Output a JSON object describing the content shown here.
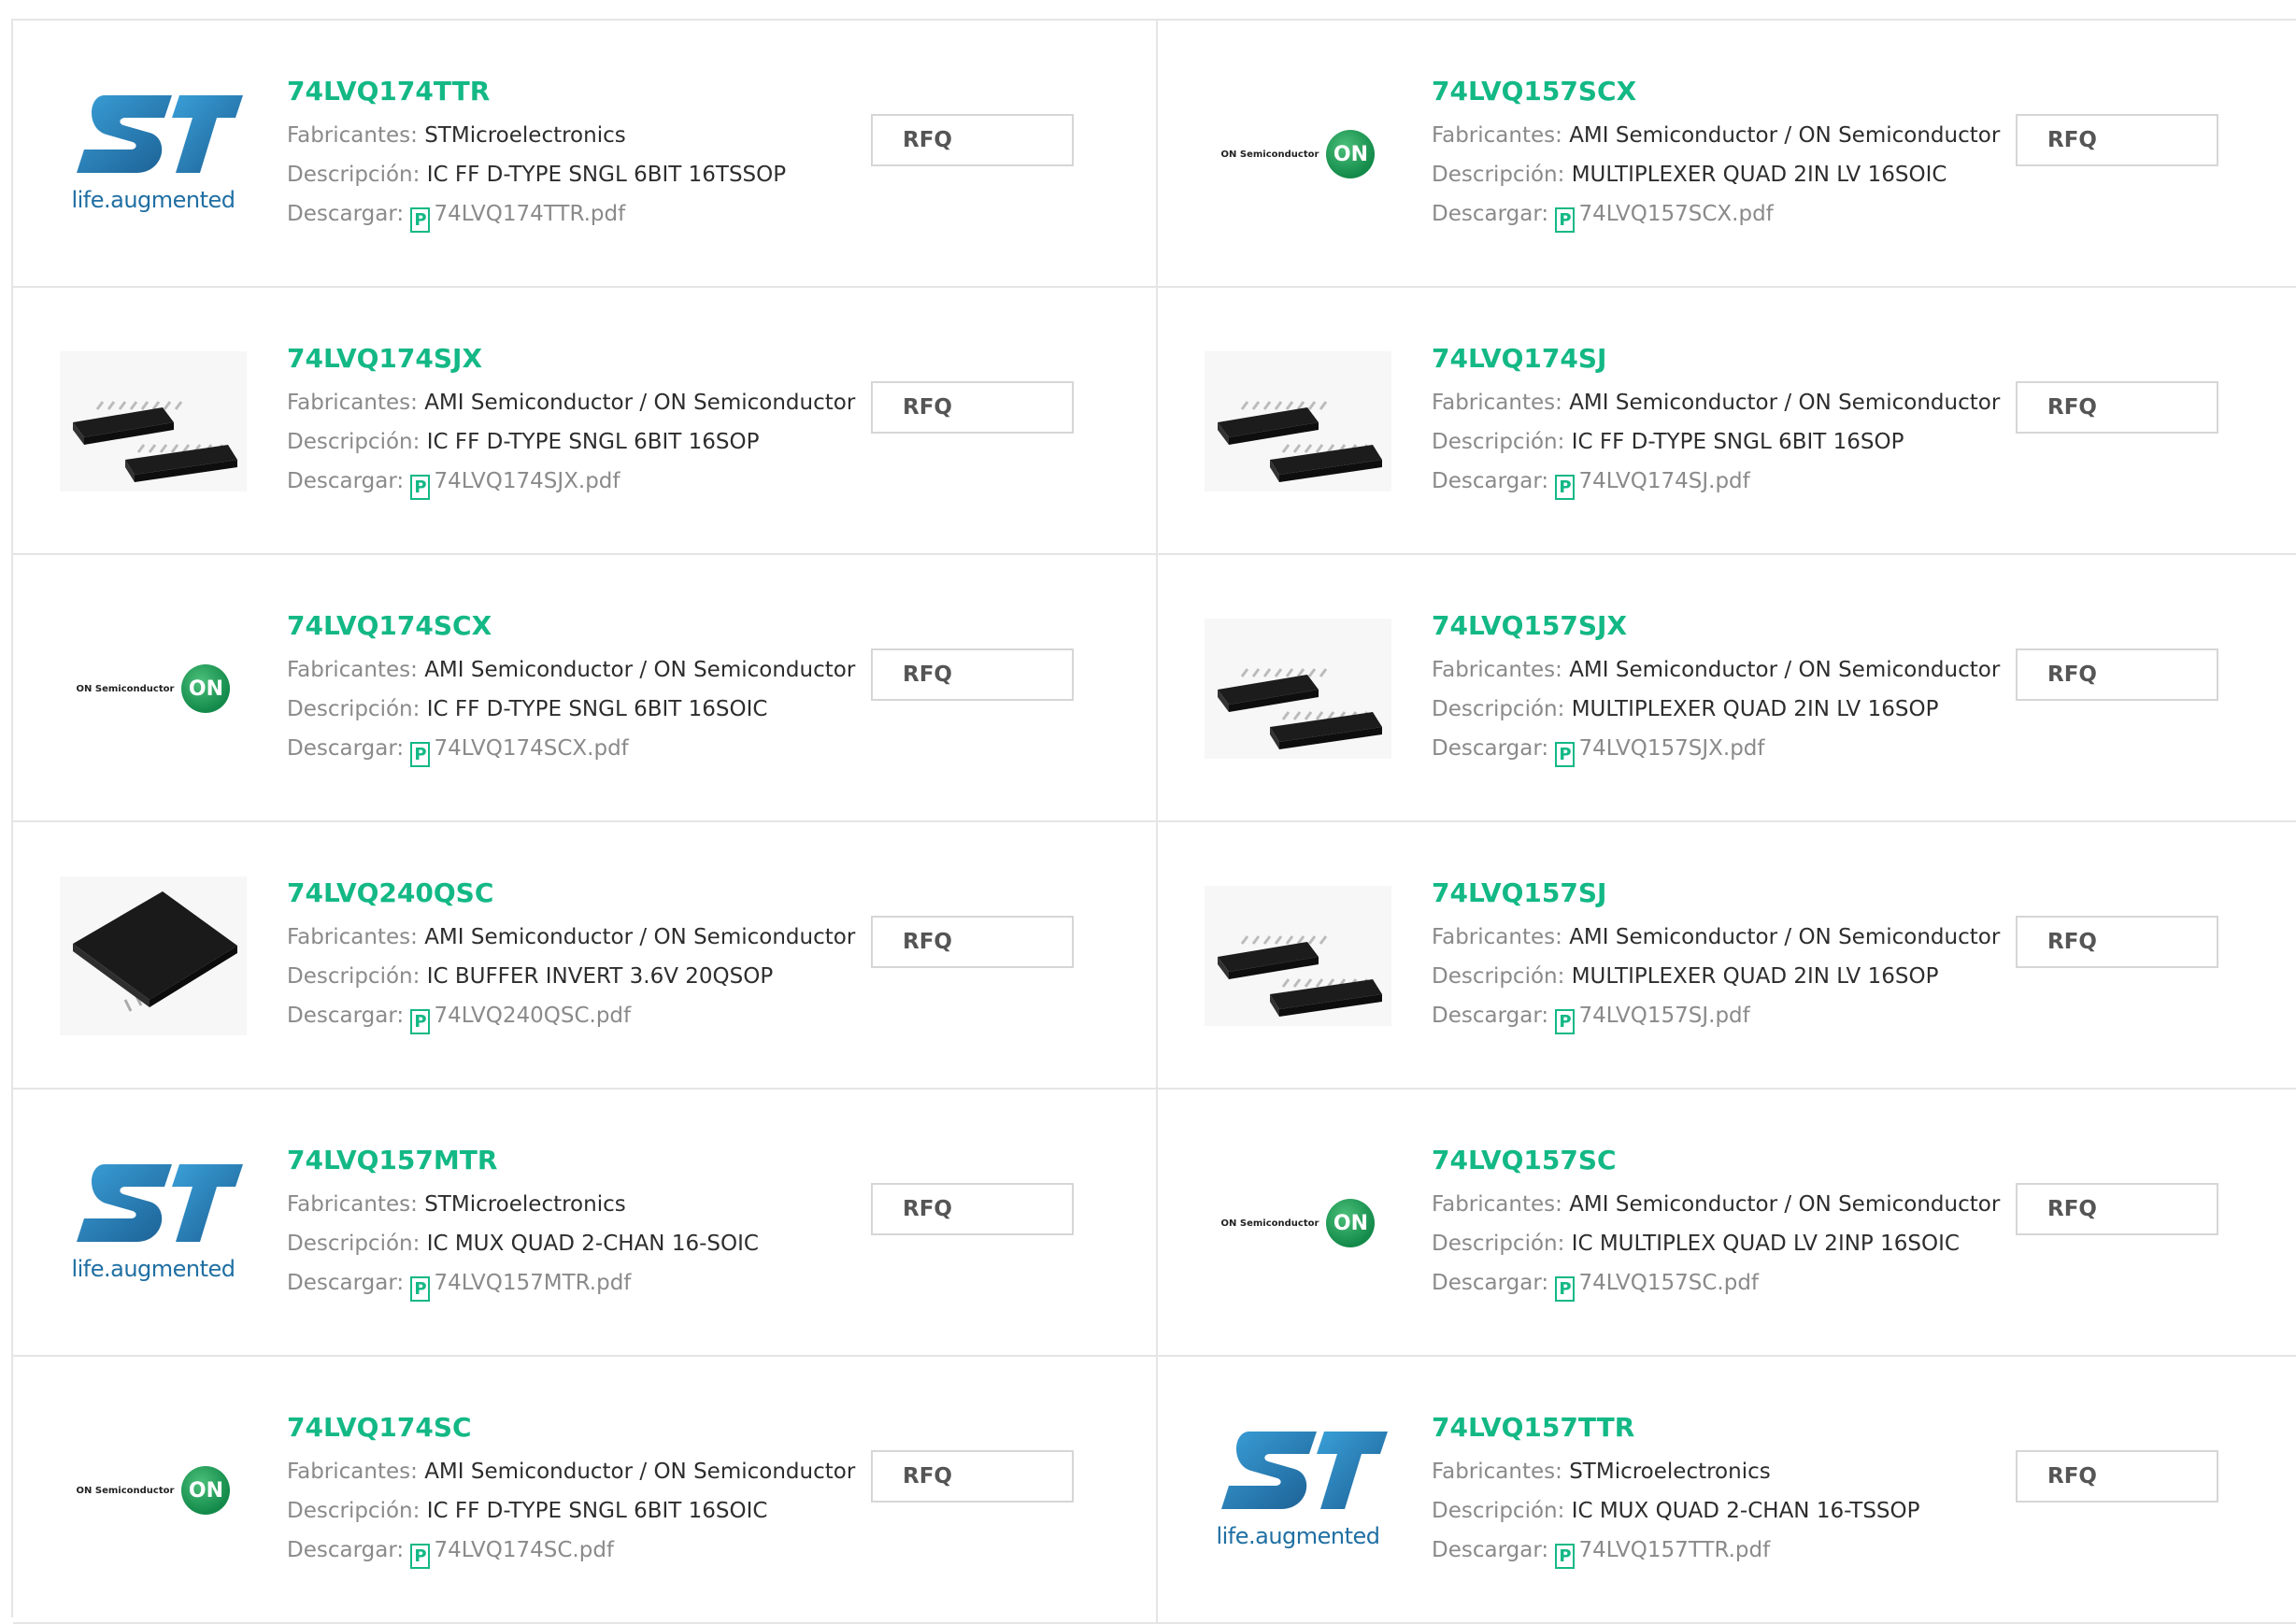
{
  "labels": {
    "manufacturer": "Fabricantes:",
    "description": "Descripción:",
    "download": "Descargar:",
    "rfq": "RFQ",
    "pdf_glyph": "P",
    "st_tagline": "life.augmented",
    "on_wordmark": "ON Semiconductor",
    "on_badge": "ON"
  },
  "colors": {
    "accent_green": "#13b885",
    "border": "#e5e5e5",
    "label_gray": "#8a8a8a",
    "st_blue": "#1f6fa3"
  },
  "products": [
    {
      "part": "74LVQ174TTR",
      "manufacturer": "STMicroelectronics",
      "description": "IC FF D-TYPE SNGL 6BIT 16TSSOP",
      "pdf": "74LVQ174TTR.pdf",
      "logo": "st"
    },
    {
      "part": "74LVQ157SCX",
      "manufacturer": "AMI Semiconductor / ON Semiconductor",
      "description": "MULTIPLEXER QUAD 2IN LV 16SOIC",
      "pdf": "74LVQ157SCX.pdf",
      "logo": "on"
    },
    {
      "part": "74LVQ174SJX",
      "manufacturer": "AMI Semiconductor / ON Semiconductor",
      "description": "IC FF D-TYPE SNGL 6BIT 16SOP",
      "pdf": "74LVQ174SJX.pdf",
      "logo": "chip-sop"
    },
    {
      "part": "74LVQ174SJ",
      "manufacturer": "AMI Semiconductor / ON Semiconductor",
      "description": "IC FF D-TYPE SNGL 6BIT 16SOP",
      "pdf": "74LVQ174SJ.pdf",
      "logo": "chip-sop"
    },
    {
      "part": "74LVQ174SCX",
      "manufacturer": "AMI Semiconductor / ON Semiconductor",
      "description": "IC FF D-TYPE SNGL 6BIT 16SOIC",
      "pdf": "74LVQ174SCX.pdf",
      "logo": "on"
    },
    {
      "part": "74LVQ157SJX",
      "manufacturer": "AMI Semiconductor / ON Semiconductor",
      "description": "MULTIPLEXER QUAD 2IN LV 16SOP",
      "pdf": "74LVQ157SJX.pdf",
      "logo": "chip-sop"
    },
    {
      "part": "74LVQ240QSC",
      "manufacturer": "AMI Semiconductor / ON Semiconductor",
      "description": "IC BUFFER INVERT 3.6V 20QSOP",
      "pdf": "74LVQ240QSC.pdf",
      "logo": "chip-qsop"
    },
    {
      "part": "74LVQ157SJ",
      "manufacturer": "AMI Semiconductor / ON Semiconductor",
      "description": "MULTIPLEXER QUAD 2IN LV 16SOP",
      "pdf": "74LVQ157SJ.pdf",
      "logo": "chip-sop"
    },
    {
      "part": "74LVQ157MTR",
      "manufacturer": "STMicroelectronics",
      "description": "IC MUX QUAD 2-CHAN 16-SOIC",
      "pdf": "74LVQ157MTR.pdf",
      "logo": "st"
    },
    {
      "part": "74LVQ157SC",
      "manufacturer": "AMI Semiconductor / ON Semiconductor",
      "description": "IC MULTIPLEX QUAD LV 2INP 16SOIC",
      "pdf": "74LVQ157SC.pdf",
      "logo": "on"
    },
    {
      "part": "74LVQ174SC",
      "manufacturer": "AMI Semiconductor / ON Semiconductor",
      "description": "IC FF D-TYPE SNGL 6BIT 16SOIC",
      "pdf": "74LVQ174SC.pdf",
      "logo": "on"
    },
    {
      "part": "74LVQ157TTR",
      "manufacturer": "STMicroelectronics",
      "description": "IC MUX QUAD 2-CHAN 16-TSSOP",
      "pdf": "74LVQ157TTR.pdf",
      "logo": "st"
    }
  ]
}
